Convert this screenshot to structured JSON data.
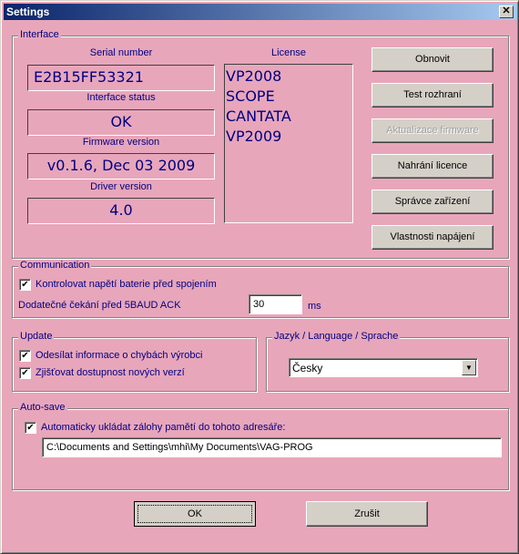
{
  "window": {
    "title": "Settings",
    "close_icon": "close-icon"
  },
  "interface": {
    "group_label": "Interface",
    "serial_label": "Serial number",
    "serial_value": "E2B15FF53321",
    "status_label": "Interface status",
    "status_value": "OK",
    "firmware_label": "Firmware version",
    "firmware_value": "v0.1.6, Dec 03 2009",
    "driver_label": "Driver version",
    "driver_value": "4.0",
    "license_label": "License",
    "licenses": [
      "VP2008",
      "SCOPE",
      "CANTATA",
      "VP2009"
    ],
    "buttons": {
      "refresh": "Obnovit",
      "test": "Test rozhraní",
      "firmware_update": "Aktualizace firmware",
      "license_upload": "Nahrání licence",
      "device_manager": "Správce zařízení",
      "power_properties": "Vlastnosti napájení"
    }
  },
  "communication": {
    "group_label": "Communication",
    "check_battery_label": "Kontrolovat napětí baterie před spojením",
    "check_battery_checked": true,
    "wait_label": "Dodatečné čekání před 5BAUD ACK",
    "wait_value": "30",
    "wait_unit": "ms"
  },
  "update": {
    "group_label": "Update",
    "send_errors_label": "Odesílat informace o chybách výrobci",
    "send_errors_checked": true,
    "check_versions_label": "Zjišťovat dostupnost nových verzí",
    "check_versions_checked": true
  },
  "language": {
    "group_label": "Jazyk / Language / Sprache",
    "selected": "Česky"
  },
  "autosave": {
    "group_label": "Auto-save",
    "auto_label": "Automaticky ukládat zálohy pamětí do tohoto adresáře:",
    "auto_checked": true,
    "path": "C:\\Documents and Settings\\mhi\\My Documents\\VAG-PROG"
  },
  "footer": {
    "ok": "OK",
    "cancel": "Zrušit"
  }
}
